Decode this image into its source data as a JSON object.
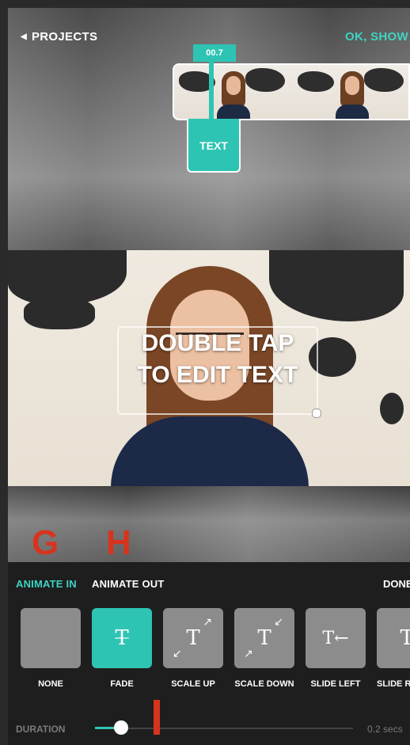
{
  "header": {
    "back_label": "PROJECTS",
    "ok_label": "OK, SHOW"
  },
  "timeline": {
    "time_badge": "00.7",
    "text_clip_label": "TEXT"
  },
  "preview": {
    "overlay_text": "DOUBLE TAP\nTO EDIT TEXT"
  },
  "annotations": {
    "label_g": "G",
    "label_h": "H"
  },
  "animation_panel": {
    "tabs": [
      {
        "label": "ANIMATE IN",
        "active": true
      },
      {
        "label": "ANIMATE OUT",
        "active": false
      }
    ],
    "done_label": "DONE",
    "items": [
      {
        "label": "NONE",
        "icon": "none-icon",
        "glyph": "",
        "active": false
      },
      {
        "label": "FADE",
        "icon": "fade-text-icon",
        "glyph": "T",
        "active": true
      },
      {
        "label": "SCALE UP",
        "icon": "scale-up-icon",
        "glyph": "T",
        "active": false
      },
      {
        "label": "SCALE DOWN",
        "icon": "scale-down-icon",
        "glyph": "T",
        "active": false
      },
      {
        "label": "SLIDE LEFT",
        "icon": "slide-left-icon",
        "glyph": "T←",
        "active": false
      },
      {
        "label": "SLIDE R",
        "icon": "slide-right-icon",
        "glyph": "T",
        "active": false
      }
    ],
    "duration_label": "DURATION",
    "duration_value": "0.2 secs",
    "duration_fraction": 0.1
  },
  "colors": {
    "accent": "#2ec4b4",
    "annotation_red": "#d7341e",
    "panel_bg": "#1e1e1e"
  }
}
